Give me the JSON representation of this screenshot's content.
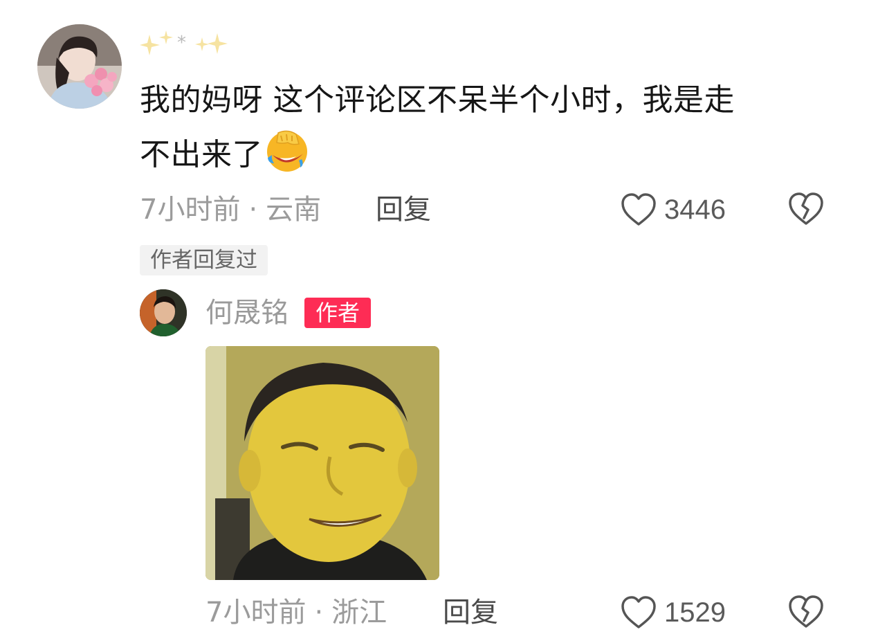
{
  "comment": {
    "username": "✨*✨",
    "text_line1": "我的妈呀 这个评论区不呆半个小时，我是走",
    "text_line2": "不出来了",
    "emoji": "facepalm-laugh-emoji",
    "time": "7小时前",
    "separator": "·",
    "location": "云南",
    "reply_label": "回复",
    "like_count": "3446",
    "author_replied_tag": "作者回复过"
  },
  "reply": {
    "username": "何晟铭",
    "author_badge": "作者",
    "image": "meme-photo-smiling-man",
    "time": "7小时前",
    "separator": "·",
    "location": "浙江",
    "reply_label": "回复",
    "like_count": "1529"
  },
  "colors": {
    "text_primary": "#161616",
    "text_meta": "#9b9b9b",
    "author_badge_bg": "#fe2c55",
    "tag_bg": "#f2f2f2"
  },
  "icons": [
    "heart-outline-icon",
    "broken-heart-dislike-icon"
  ]
}
